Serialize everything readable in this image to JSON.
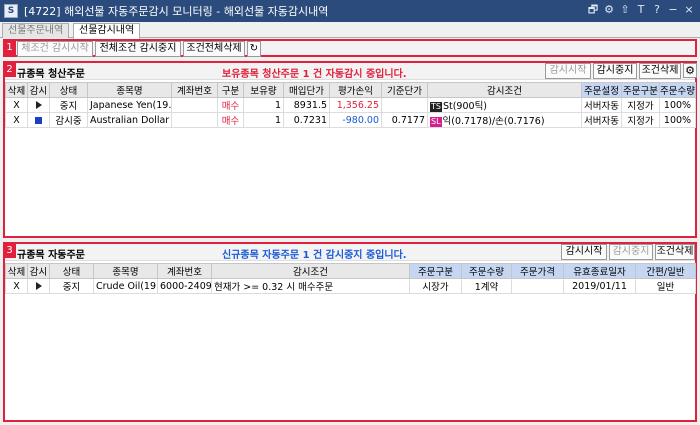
{
  "window": {
    "title": "[4722] 해외선물 자동주문감시 모니터링 - 해외선물 자동감시내역",
    "app_icon": "app-icon",
    "title_buttons": [
      "🗗",
      "⚙",
      "⇧",
      "T",
      "?",
      "−",
      "×"
    ]
  },
  "tabs": [
    {
      "label": "선물주문내역",
      "active": false
    },
    {
      "label": "선물감시내역",
      "active": true
    }
  ],
  "markers": [
    "1",
    "2",
    "3"
  ],
  "toolbar": {
    "btn_start": "체조건 감시시작",
    "btn_stop": "전체조건 감시중지",
    "btn_delete": "조건전체삭제",
    "refresh_icon": "refresh-icon",
    "refresh_glyph": "↻"
  },
  "panel_close": {
    "title": "규종목 청산주문",
    "message": "보유종목 청산주문 1 건 자동감시 중입니다.",
    "btn_start": "감시시작",
    "btn_stop": "감시중지",
    "btn_delete": "조건삭제",
    "gear_glyph": "⚙",
    "columns": [
      "삭제",
      "감시",
      "상태",
      "종목명",
      "계좌번호",
      "구분",
      "보유량",
      "매입단가",
      "평가손익",
      "기준단가",
      "감시조건",
      "주문설정",
      "주문구분",
      "주문수량"
    ],
    "rows": [
      {
        "del": "X",
        "watch_icon": "play-icon",
        "state": "중지",
        "name": "Japanese Yen(19.0",
        "account": "",
        "side": "매수",
        "qty": "1",
        "price": "8931.5",
        "pnl": "1,356.25",
        "pnl_color": "red",
        "base": "",
        "badge": "TS",
        "badge_type": "ts",
        "cond": "St(900틱)",
        "setting": "서버자동",
        "ord_type": "지정가",
        "ord_qty": "100%"
      },
      {
        "del": "X",
        "watch_icon": "stop-icon",
        "state": "감시중",
        "name": "Australian Dollar",
        "account": "",
        "side": "매수",
        "qty": "1",
        "price": "0.7231",
        "pnl": "-980.00",
        "pnl_color": "blue",
        "base": "0.7177",
        "badge": "SL",
        "badge_type": "sl",
        "cond": "익(0.7178)/손(0.7176)",
        "setting": "서버자동",
        "ord_type": "지정가",
        "ord_qty": "100%"
      }
    ]
  },
  "panel_new": {
    "title": "규종목 자동주문",
    "message": "신규종목 자동주문 1 건 감시중지 중입니다.",
    "btn_start": "감시시작",
    "btn_stop": "감시중지",
    "btn_delete": "조건삭제",
    "columns": [
      "삭제",
      "감시",
      "상태",
      "종목명",
      "계좌번호",
      "감시조건",
      "주문구분",
      "주문수량",
      "주문가격",
      "유효종료일자",
      "간편/일반"
    ],
    "rows": [
      {
        "del": "X",
        "watch_icon": "play-icon",
        "state": "중지",
        "name": "Crude Oil(19.",
        "account": "6000-2409",
        "cond": "현재가 >= 0.32 시 매수주문",
        "ord_type": "시장가",
        "ord_qty": "1계약",
        "ord_price": "",
        "expiry": "2019/01/11",
        "mode": "일반"
      }
    ]
  }
}
